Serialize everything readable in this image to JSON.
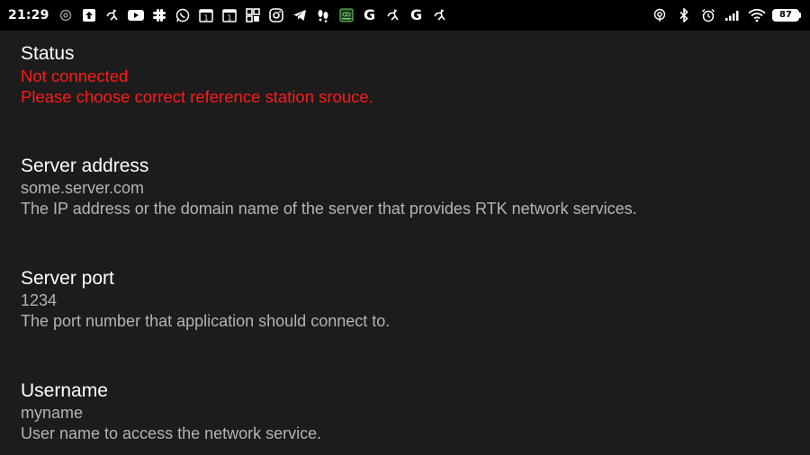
{
  "status_bar": {
    "time": "21:29",
    "battery": "87",
    "left_icons": [
      "at-icon",
      "upload-icon",
      "ostrich-icon",
      "youtube-icon",
      "slack-icon",
      "whatsapp-icon",
      "calendar-1-icon",
      "calendar-1-icon",
      "qr-code-icon",
      "instagram-icon",
      "telegram-icon",
      "footprints-icon",
      "gps-app-icon",
      "google-icon",
      "ostrich-icon",
      "google-icon",
      "ostrich-icon"
    ],
    "right_icons": [
      "hotspot-icon",
      "bluetooth-icon",
      "alarm-icon",
      "signal-icon",
      "wifi-icon",
      "battery-icon"
    ],
    "glyphs": {
      "google": "G",
      "calendar": "1"
    }
  },
  "preferences": [
    {
      "id": "status",
      "title": "Status",
      "lines": [
        "Not connected",
        "Please choose correct reference station srouce."
      ],
      "error": true
    },
    {
      "id": "server-address",
      "title": "Server address",
      "value": "some.server.com",
      "description": "The IP address or the domain name of the server that provides RTK network services."
    },
    {
      "id": "server-port",
      "title": "Server port",
      "value": "1234",
      "description": "The port number that application should connect to."
    },
    {
      "id": "username",
      "title": "Username",
      "value": "myname",
      "description": "User name to access the network service."
    }
  ],
  "colors": {
    "background": "#1c1c1c",
    "title": "#ffffff",
    "secondary": "#b4b4b4",
    "error": "#ff1a1a"
  }
}
